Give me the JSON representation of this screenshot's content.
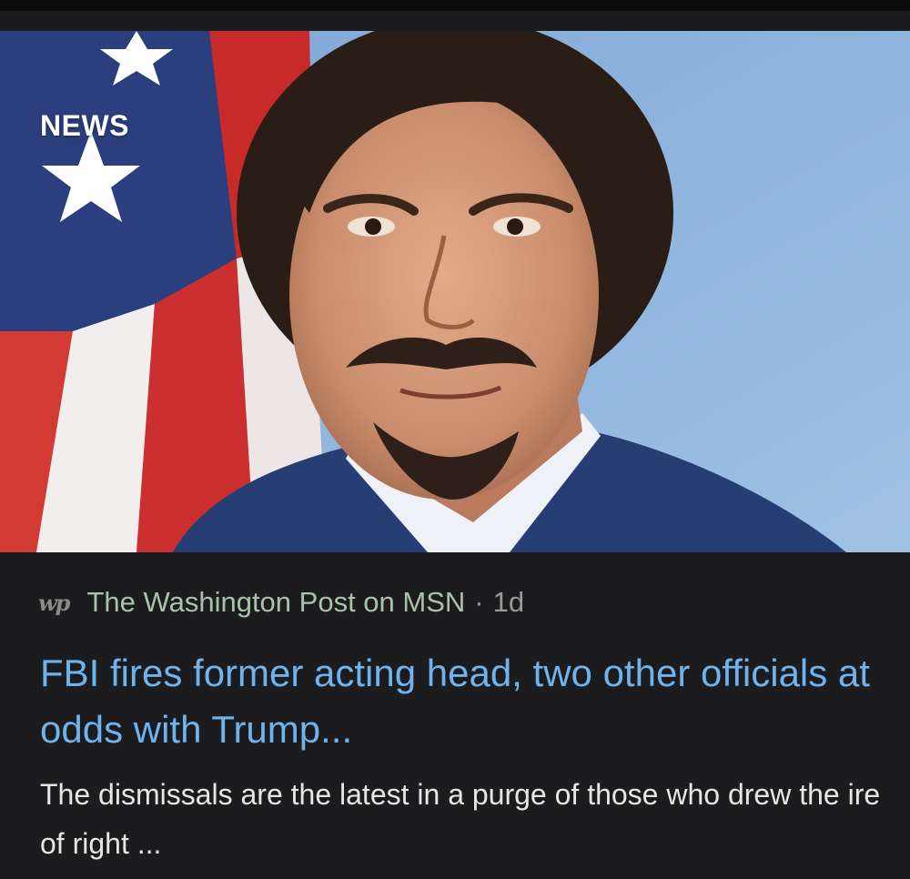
{
  "article": {
    "category": "NEWS",
    "source_logo_text": "wp",
    "source": "The Washington Post on MSN",
    "separator": "·",
    "age": "1d",
    "headline": "FBI fires former acting head, two other officials at odds with Trump...",
    "snippet": "The dismissals are the latest in a purge of those who drew the ire of right ..."
  },
  "colors": {
    "background": "#1c1c1e",
    "headline": "#6fb3ee",
    "source": "#a9c3ab",
    "meta": "#9a9a9a",
    "snippet": "#e6e6e6"
  }
}
